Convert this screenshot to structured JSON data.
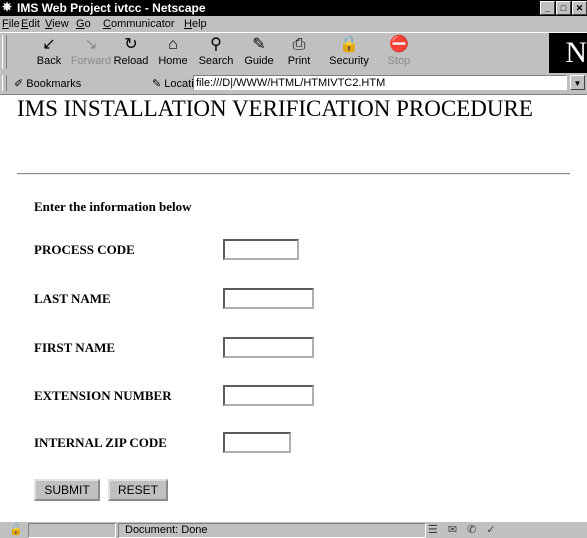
{
  "window": {
    "title": "IMS Web Project ivtcc - Netscape",
    "buttons": [
      "_",
      "□",
      "✕"
    ]
  },
  "menu": [
    {
      "pre": "",
      "u": "F",
      "post": "ile"
    },
    {
      "pre": "",
      "u": "E",
      "post": "dit"
    },
    {
      "pre": "",
      "u": "V",
      "post": "iew"
    },
    {
      "pre": "",
      "u": "G",
      "post": "o"
    },
    {
      "pre": "",
      "u": "C",
      "post": "ommunicator"
    },
    {
      "pre": "",
      "u": "H",
      "post": "elp"
    }
  ],
  "toolbar": {
    "buttons": [
      {
        "label": "Back",
        "icon": "↙"
      },
      {
        "label": "Forward",
        "icon": "↘"
      },
      {
        "label": "Reload",
        "icon": "↻"
      },
      {
        "label": "Home",
        "icon": "⌂"
      },
      {
        "label": "Search",
        "icon": "⚲"
      },
      {
        "label": "Guide",
        "icon": "✎"
      },
      {
        "label": "Print",
        "icon": "⎙"
      },
      {
        "label": "Security",
        "icon": "🔒"
      },
      {
        "label": "Stop",
        "icon": "⛔"
      }
    ],
    "logo": "N"
  },
  "location": {
    "bookmarks_label": "Bookmarks",
    "location_label": "Location:",
    "url": "file:///D|/WWW/HTML/HTMIVTC2.HTM"
  },
  "page": {
    "heading": "IMS INSTALLATION VERIFICATION PROCEDURE",
    "intro": "Enter the information below",
    "fields": [
      {
        "label": "PROCESS CODE",
        "value": ""
      },
      {
        "label": "LAST NAME",
        "value": ""
      },
      {
        "label": "FIRST NAME",
        "value": ""
      },
      {
        "label": "EXTENSION NUMBER",
        "value": ""
      },
      {
        "label": "INTERNAL ZIP CODE",
        "value": ""
      }
    ],
    "submit_label": "SUBMIT",
    "reset_label": "RESET"
  },
  "status": {
    "text": "Document: Done"
  }
}
